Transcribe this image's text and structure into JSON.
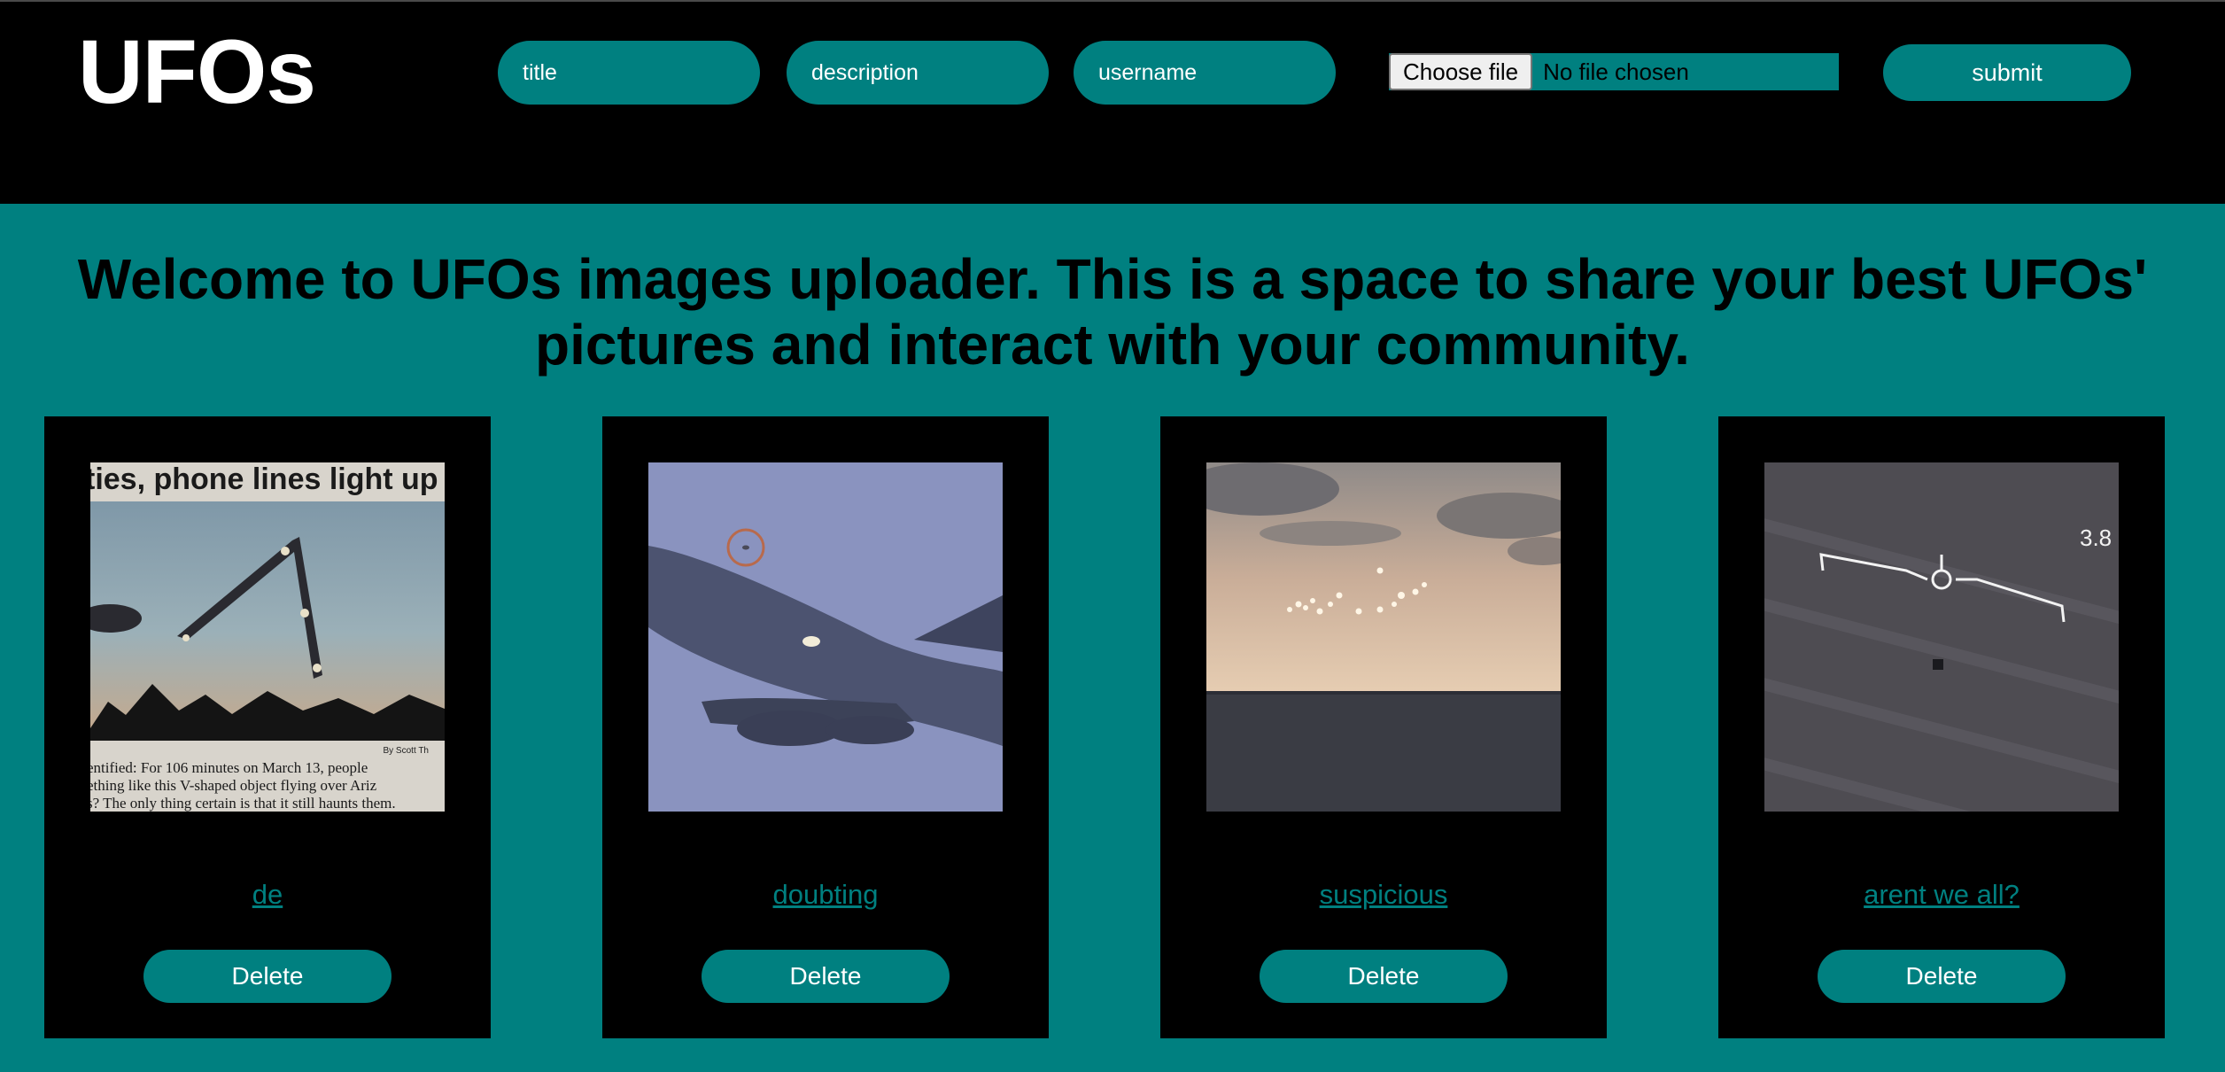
{
  "header": {
    "logo": "UFOs",
    "title_placeholder": "title",
    "description_placeholder": "description",
    "username_placeholder": "username",
    "file_button_label": "Choose file",
    "file_status": "No file chosen",
    "submit_label": "submit"
  },
  "welcome": {
    "line1": "Welcome to UFOs images uploader. This is a space to share your best UFOs'",
    "line2": "pictures and interact with your community."
  },
  "cards": [
    {
      "title": "de",
      "delete_label": "Delete",
      "image": "newspaper-v-shaped-ufo-photo"
    },
    {
      "title": "doubting",
      "delete_label": "Delete",
      "image": "airplane-with-circled-object-photo"
    },
    {
      "title": "suspicious",
      "delete_label": "Delete",
      "image": "lights-over-ocean-sunset-photo"
    },
    {
      "title": "arent we all?",
      "delete_label": "Delete",
      "image": "infrared-targeting-footage-photo"
    }
  ],
  "photo_text": {
    "newspaper_headline": "ties, phone lines light up Ari",
    "newspaper_byline": "By Scott Th",
    "newspaper_body_1": "entified: For 106 minutes on March 13, people",
    "newspaper_body_2": "ething like this V-shaped object flying over Ariz",
    "newspaper_body_3": "s? The only thing certain is that it still haunts them.",
    "infrared_readout": "3.8"
  },
  "colors": {
    "teal": "#008080",
    "black": "#000000",
    "white": "#ffffff"
  }
}
